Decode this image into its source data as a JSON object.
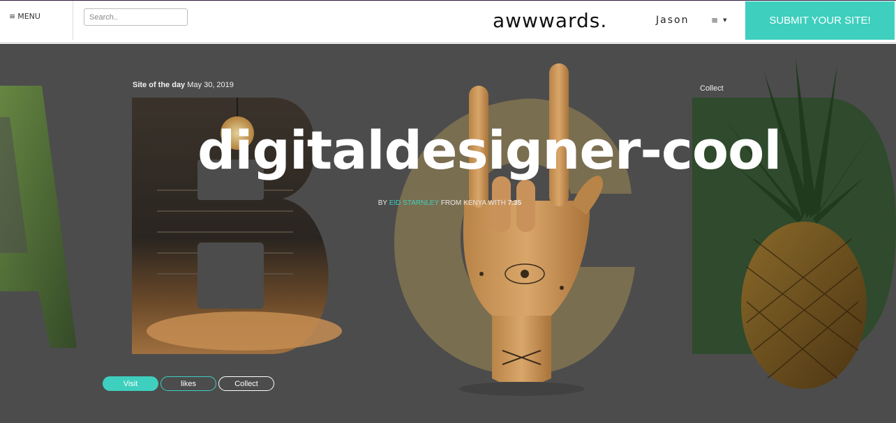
{
  "header": {
    "menu_icon": "≡",
    "menu_label": "MENU",
    "search_placeholder": "Search..",
    "logo_text": "awwwards.",
    "user_name": "Jason",
    "nav_icon": "≡",
    "nav_caret": "▼",
    "submit_label": "SUBMIT YOUR SITE!"
  },
  "hero": {
    "badge_label": "Site of the day",
    "date": "May 30, 2019",
    "collect_top_label": "Collect",
    "title": "digitaldesigner-cool",
    "byline": {
      "by": "BY",
      "author": "EID STARNLEY",
      "from": "FROM KENYA WITH",
      "score": "7.35"
    },
    "buttons": {
      "visit": "Visit",
      "likes": "likes",
      "collect": "Collect"
    }
  },
  "colors": {
    "accent": "#3ecfbe",
    "hero_bg": "#4c4c4c",
    "white": "#ffffff"
  }
}
